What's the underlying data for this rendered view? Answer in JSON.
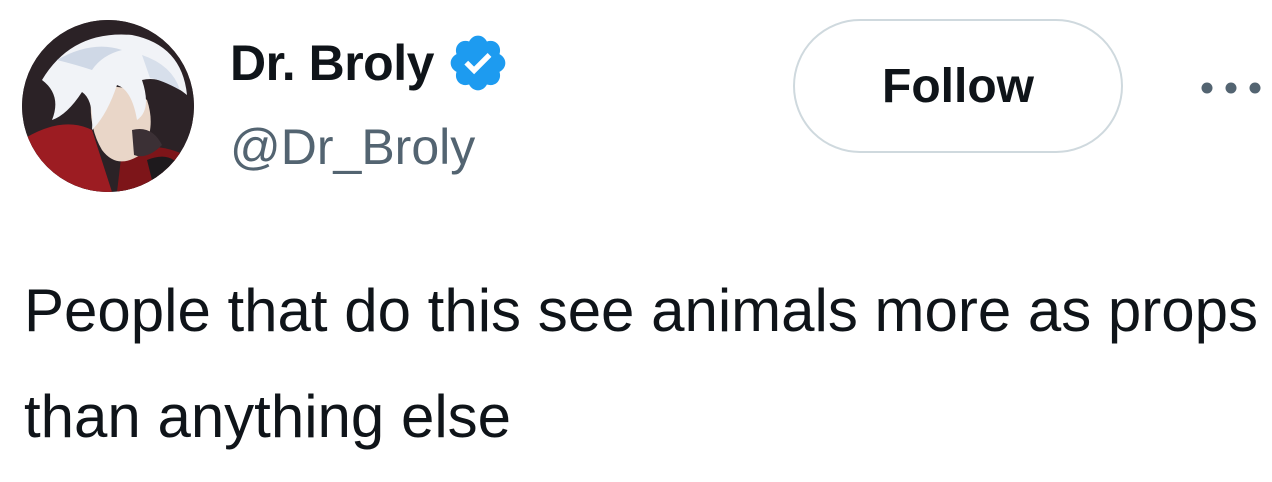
{
  "author": {
    "display_name": "Dr. Broly",
    "handle": "@Dr_Broly",
    "verified": true,
    "avatar_icon": "avatar-image"
  },
  "actions": {
    "follow_label": "Follow",
    "more_icon": "more-horizontal-icon"
  },
  "tweet": {
    "text": "People that do this see animals more as props than anything else"
  },
  "colors": {
    "text_primary": "#0f1419",
    "text_secondary": "#536471",
    "verified_blue": "#1d9bf0",
    "button_border": "#cfd9de"
  }
}
